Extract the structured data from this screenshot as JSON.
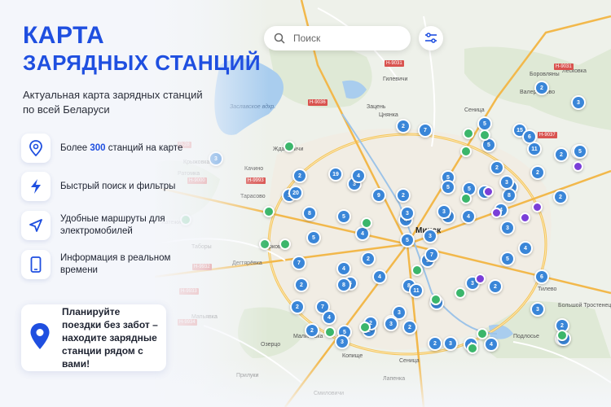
{
  "title": {
    "line1": "КАРТА",
    "line2": "ЗАРЯДНЫХ СТАНЦИЙ"
  },
  "subtitle": "Актуальная карта зарядных станций по всей Беларуси",
  "features": [
    {
      "icon": "map-pin-icon",
      "pre": "Более ",
      "highlight": "300",
      "post": " станций на карте"
    },
    {
      "icon": "lightning-icon",
      "text": "Быстрый поиск и фильтры"
    },
    {
      "icon": "navigation-arrow-icon",
      "text": "Удобные маршруты для электромобилей"
    },
    {
      "icon": "smartphone-icon",
      "text": "Информация в реальном времени"
    }
  ],
  "promo": {
    "icon": "location-pin-icon",
    "text": "Планируйте поездки без забот – находите зарядные станции рядом с вами!"
  },
  "search": {
    "placeholder": "Поиск"
  },
  "colors": {
    "accent": "#1f4fe0",
    "cluster": "#3a86d8",
    "green": "#3bb66b",
    "purple": "#7a3fd8"
  },
  "map": {
    "city": "Минск",
    "water_label": "Заславское вдхр.",
    "places": [
      "Боровляны",
      "Лесковка",
      "Гилевичи",
      "Сеница",
      "Валерьяново",
      "Зацень",
      "Цнянка",
      "Крыжовка",
      "Ратомка",
      "Ждановичи",
      "Качино",
      "Тарасово",
      "Хатежино",
      "Таборы",
      "Дегтярёвка",
      "Ярково",
      "Мапьявка",
      "Озерцо",
      "Прилуки",
      "Малиновка",
      "Копище",
      "Сеница",
      "Смиловичи",
      "Лапенка",
      "Тилево",
      "Большой Тростенец",
      "Подлосье",
      "Колодищи",
      "Новая Боровая",
      "Цнянка"
    ],
    "road_codes": [
      "Н-9031",
      "Н-9036",
      "Р-28",
      "Н-9000",
      "Н-9993",
      "Н-9932",
      "Н-9933",
      "Н-9934",
      "Н-9037",
      "Н-9031"
    ],
    "clusters": [
      {
        "n": "2"
      },
      {
        "n": "3"
      },
      {
        "n": "5"
      },
      {
        "n": "2"
      },
      {
        "n": "7"
      },
      {
        "n": "5"
      },
      {
        "n": "15"
      },
      {
        "n": "6"
      },
      {
        "n": "11"
      },
      {
        "n": "2"
      },
      {
        "n": "3"
      },
      {
        "n": "2"
      },
      {
        "n": "3"
      },
      {
        "n": "5"
      },
      {
        "n": "2"
      },
      {
        "n": "3"
      },
      {
        "n": "19"
      },
      {
        "n": "4"
      },
      {
        "n": "2"
      },
      {
        "n": "3"
      },
      {
        "n": "9"
      },
      {
        "n": "5"
      },
      {
        "n": "3"
      },
      {
        "n": "20"
      },
      {
        "n": "8"
      },
      {
        "n": "5"
      },
      {
        "n": "4"
      },
      {
        "n": "5"
      },
      {
        "n": "7"
      },
      {
        "n": "4"
      },
      {
        "n": "2"
      },
      {
        "n": "5"
      },
      {
        "n": "4"
      },
      {
        "n": "3"
      },
      {
        "n": "5"
      },
      {
        "n": "5"
      },
      {
        "n": "8"
      },
      {
        "n": "4"
      },
      {
        "n": "3"
      },
      {
        "n": "7"
      },
      {
        "n": "2"
      },
      {
        "n": "2"
      },
      {
        "n": "3"
      },
      {
        "n": "4"
      },
      {
        "n": "5"
      },
      {
        "n": "3"
      },
      {
        "n": "4"
      },
      {
        "n": "6"
      },
      {
        "n": "8"
      },
      {
        "n": "3"
      },
      {
        "n": "4"
      },
      {
        "n": "5"
      },
      {
        "n": "8"
      },
      {
        "n": "4"
      },
      {
        "n": "7"
      },
      {
        "n": "8"
      },
      {
        "n": "11"
      },
      {
        "n": "2"
      },
      {
        "n": "4"
      },
      {
        "n": "3"
      },
      {
        "n": "2"
      },
      {
        "n": "5"
      },
      {
        "n": "2"
      },
      {
        "n": "2"
      },
      {
        "n": "3"
      },
      {
        "n": "3"
      },
      {
        "n": "4"
      },
      {
        "n": "4"
      },
      {
        "n": "2"
      },
      {
        "n": "2"
      },
      {
        "n": "3"
      },
      {
        "n": "2"
      },
      {
        "n": "2"
      },
      {
        "n": "2"
      },
      {
        "n": "3"
      },
      {
        "n": "2"
      },
      {
        "n": "2"
      },
      {
        "n": "3"
      },
      {
        "n": "2"
      },
      {
        "n": "3"
      },
      {
        "n": "5"
      },
      {
        "n": "2"
      }
    ]
  }
}
